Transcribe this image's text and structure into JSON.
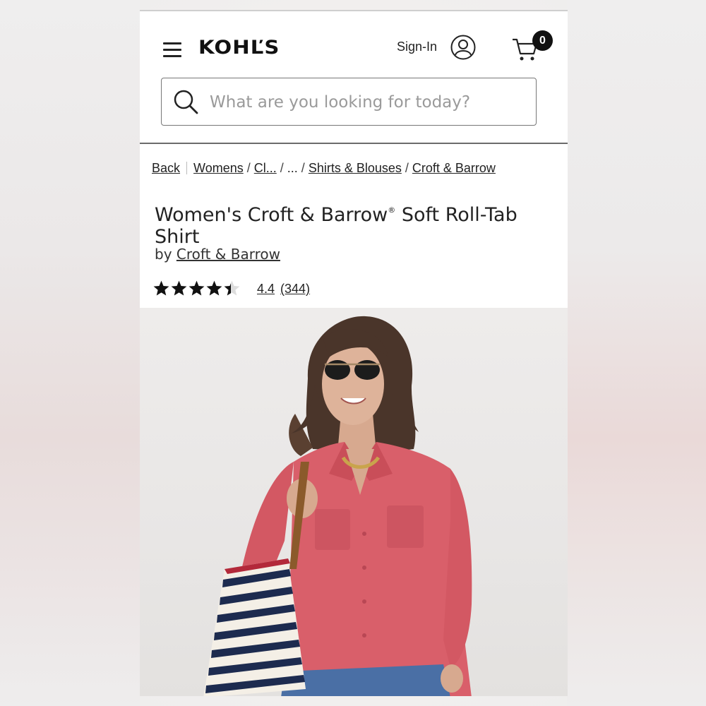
{
  "header": {
    "logo_text": "KOHĽS",
    "signin_label": "Sign-In",
    "cart_count": "0",
    "menu_icon": "hamburger-icon",
    "user_icon": "user-icon",
    "cart_icon": "cart-icon"
  },
  "search": {
    "placeholder": "What are you looking for today?",
    "icon": "search-icon"
  },
  "breadcrumb": {
    "back": "Back",
    "items": [
      "Womens",
      "Cl...",
      "...",
      "Shirts & Blouses",
      "Croft & Barrow"
    ],
    "separator": "/"
  },
  "product": {
    "title_part1": "Women's Croft & Barrow",
    "title_reg": "®",
    "title_part2": " Soft Roll-Tab Shirt",
    "by_prefix": "by",
    "brand": "Croft & Barrow",
    "rating_value": "4.4",
    "rating_stars": 4.4,
    "review_count": "(344)"
  },
  "image": {
    "alt": "Woman with sunglasses wearing a pink button-up shirt and carrying a striped tote bag"
  },
  "colors": {
    "shirt": "#d95f6a",
    "text": "#222222",
    "star": "#111111"
  }
}
